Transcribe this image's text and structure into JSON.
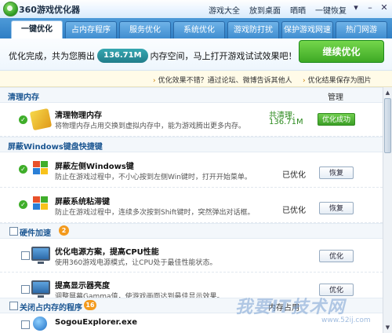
{
  "window": {
    "title": "360游戏优化器",
    "links": [
      "游戏大全",
      "放到桌面",
      "晒晒",
      "一键恢复"
    ]
  },
  "tabs": [
    "一键优化",
    "占内存程序",
    "服务优化",
    "系统优化",
    "游戏防打扰",
    "保护游戏网速",
    "热门网游"
  ],
  "banner": {
    "text_before": "优化完成，共为您腾出",
    "freed": "136.71M",
    "text_after": "内存空间，马上打开游戏试试效果吧！",
    "button": "继续优化"
  },
  "feedback": {
    "left": "优化效果不错？通过论坛、微博告诉其他人",
    "right": "优化结果保存为图片"
  },
  "sections": {
    "clean_memory": {
      "title": "清理内存",
      "manage": "管理"
    },
    "block_win": {
      "title": "屏蔽Windows键盘快捷键"
    },
    "hardware": {
      "title": "硬件加速",
      "badge": "2"
    },
    "close_programs": {
      "title": "关闭占内存的程序",
      "badge": "16",
      "column": "内存占用"
    }
  },
  "items": {
    "clean_memory": {
      "title": "清理物理内存",
      "desc": "将物理内存占用交换到虚拟内存中，能为游戏腾出更多内存。",
      "status_label": "共清理:",
      "status_value": "136.71M",
      "button": "优化成功"
    },
    "block_left_win": {
      "title": "屏蔽左侧Windows键",
      "desc": "防止在游戏过程中，不小心按到左侧Win键时，打开开始菜单。",
      "status": "已优化",
      "button": "恢复"
    },
    "block_sticky": {
      "title": "屏蔽系统粘滞键",
      "desc": "防止在游戏过程中，连续多次按到Shift键时，突然弹出对话框。",
      "status": "已优化",
      "button": "恢复"
    },
    "power_plan": {
      "title": "优化电源方案，提高CPU性能",
      "desc": "使用360游戏电源模式，让CPU处于最佳性能状态。",
      "button": "优化"
    },
    "brightness": {
      "title": "提高显示器亮度",
      "desc": "调整屏幕Gamma值，使游戏画面达到最佳显示效果。",
      "button": "优化"
    },
    "sogou": {
      "title": "SogouExplorer.exe"
    }
  },
  "watermark": {
    "main": "我要IT技术网",
    "sub": "www.52ij.com"
  },
  "colors": {
    "accent": "#2f7ec4",
    "success": "#3ea925",
    "badge": "#217d8a"
  }
}
